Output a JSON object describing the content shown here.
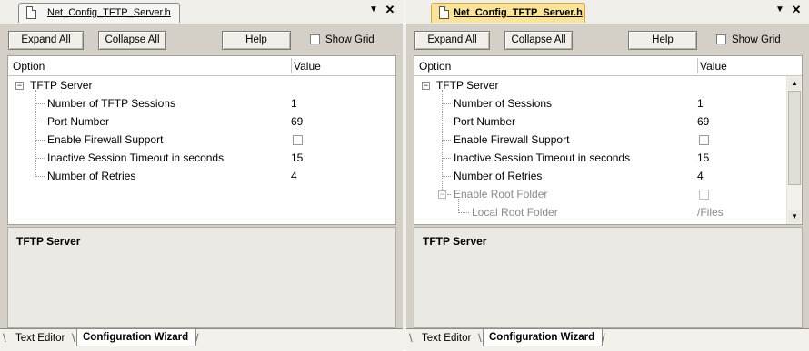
{
  "left": {
    "doc_tab": "Net_Config_TFTP_Server.h",
    "toolbar": {
      "expand": "Expand All",
      "collapse": "Collapse All",
      "help": "Help",
      "show_grid": "Show Grid"
    },
    "columns": {
      "option": "Option",
      "value": "Value"
    },
    "root": {
      "expander": "−",
      "label": "TFTP Server"
    },
    "rows": [
      {
        "label": "Number of TFTP Sessions",
        "value": "1"
      },
      {
        "label": "Port Number",
        "value": "69"
      },
      {
        "label": "Enable Firewall Support",
        "value": ""
      },
      {
        "label": "Inactive Session Timeout in seconds",
        "value": "15"
      },
      {
        "label": "Number of Retries",
        "value": "4"
      }
    ],
    "description_title": "TFTP Server",
    "bottom_tabs": {
      "text_editor": "Text Editor",
      "config_wizard": "Configuration Wizard"
    }
  },
  "right": {
    "doc_tab": "Net_Config_TFTP_Server.h",
    "toolbar": {
      "expand": "Expand All",
      "collapse": "Collapse All",
      "help": "Help",
      "show_grid": "Show Grid"
    },
    "columns": {
      "option": "Option",
      "value": "Value"
    },
    "root": {
      "expander": "−",
      "label": "TFTP Server"
    },
    "rows": [
      {
        "label": "Number of Sessions",
        "value": "1"
      },
      {
        "label": "Port Number",
        "value": "69"
      },
      {
        "label": "Enable Firewall Support",
        "value": ""
      },
      {
        "label": "Inactive Session Timeout in seconds",
        "value": "15"
      },
      {
        "label": "Number of Retries",
        "value": "4"
      },
      {
        "label": "Enable Root Folder",
        "value": "",
        "expander": "−"
      },
      {
        "label": "Local Root Folder",
        "value": "/Files"
      }
    ],
    "description_title": "TFTP Server",
    "bottom_tabs": {
      "text_editor": "Text Editor",
      "config_wizard": "Configuration Wizard"
    }
  },
  "window_buttons": {
    "dropdown": "▼",
    "close": "✕"
  },
  "scroll_arrows": {
    "up": "▲",
    "down": "▼"
  }
}
